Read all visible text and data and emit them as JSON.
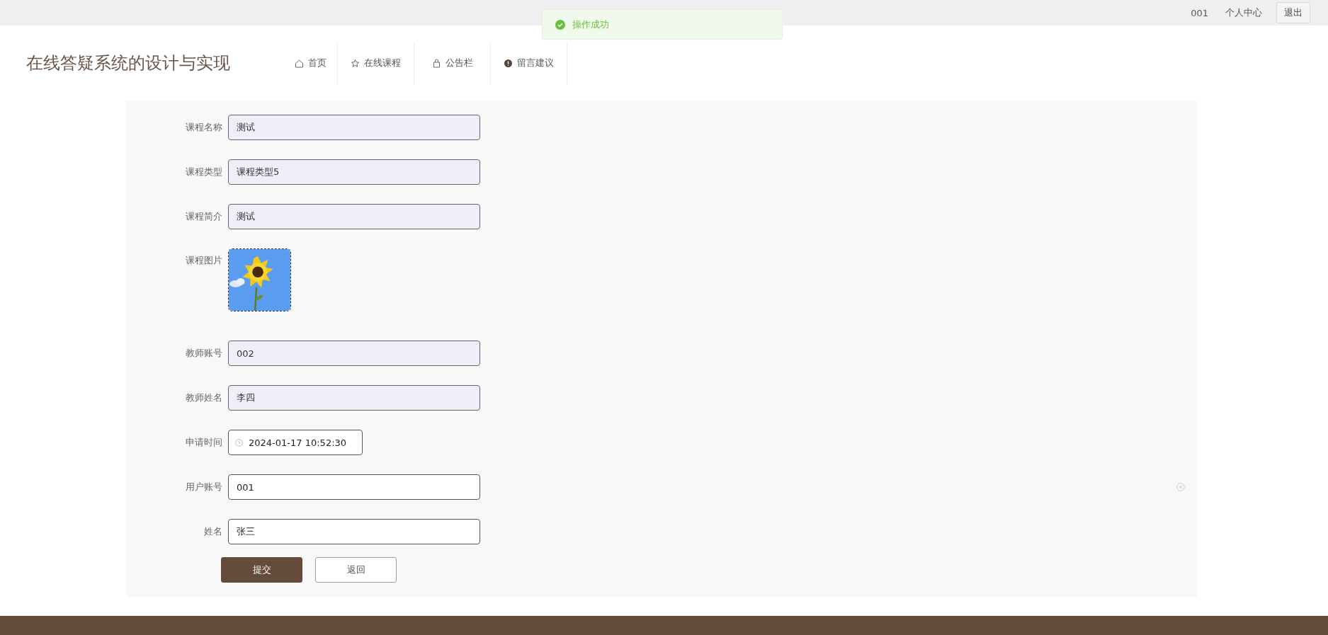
{
  "topbar": {
    "username": "001",
    "profile_link": "个人中心",
    "logout_button": "退出"
  },
  "toast": {
    "kind": "success",
    "message": "操作成功"
  },
  "header": {
    "title": "在线答疑系统的设计与实现"
  },
  "nav": [
    {
      "kind": "home",
      "label": "首页"
    },
    {
      "kind": "star",
      "label": "在线课程"
    },
    {
      "kind": "bag",
      "label": "公告栏"
    },
    {
      "kind": "alert",
      "label": "留言建议"
    }
  ],
  "form": {
    "fields": [
      {
        "kind": "text",
        "label": "课程名称",
        "value": "测试",
        "disabled": true
      },
      {
        "kind": "text",
        "label": "课程类型",
        "value": "课程类型5",
        "disabled": true
      },
      {
        "kind": "text",
        "label": "课程简介",
        "value": "测试",
        "disabled": true
      },
      {
        "label": "课程图片"
      },
      {
        "kind": "text",
        "label": "教师账号",
        "value": "002",
        "disabled": true
      },
      {
        "kind": "text",
        "label": "教师姓名",
        "value": "李四",
        "disabled": true
      },
      {
        "kind": "datetime",
        "label": "申请时间",
        "value": "2024-01-17 10:52:30",
        "disabled": false
      },
      {
        "kind": "text",
        "label": "用户账号",
        "value": "001",
        "disabled": false,
        "clearable": true
      },
      {
        "kind": "text",
        "label": "姓名",
        "value": "张三",
        "disabled": false
      }
    ],
    "buttons": [
      {
        "kind": "primary",
        "label": "提交"
      },
      {
        "kind": "default",
        "label": "返回"
      }
    ]
  }
}
